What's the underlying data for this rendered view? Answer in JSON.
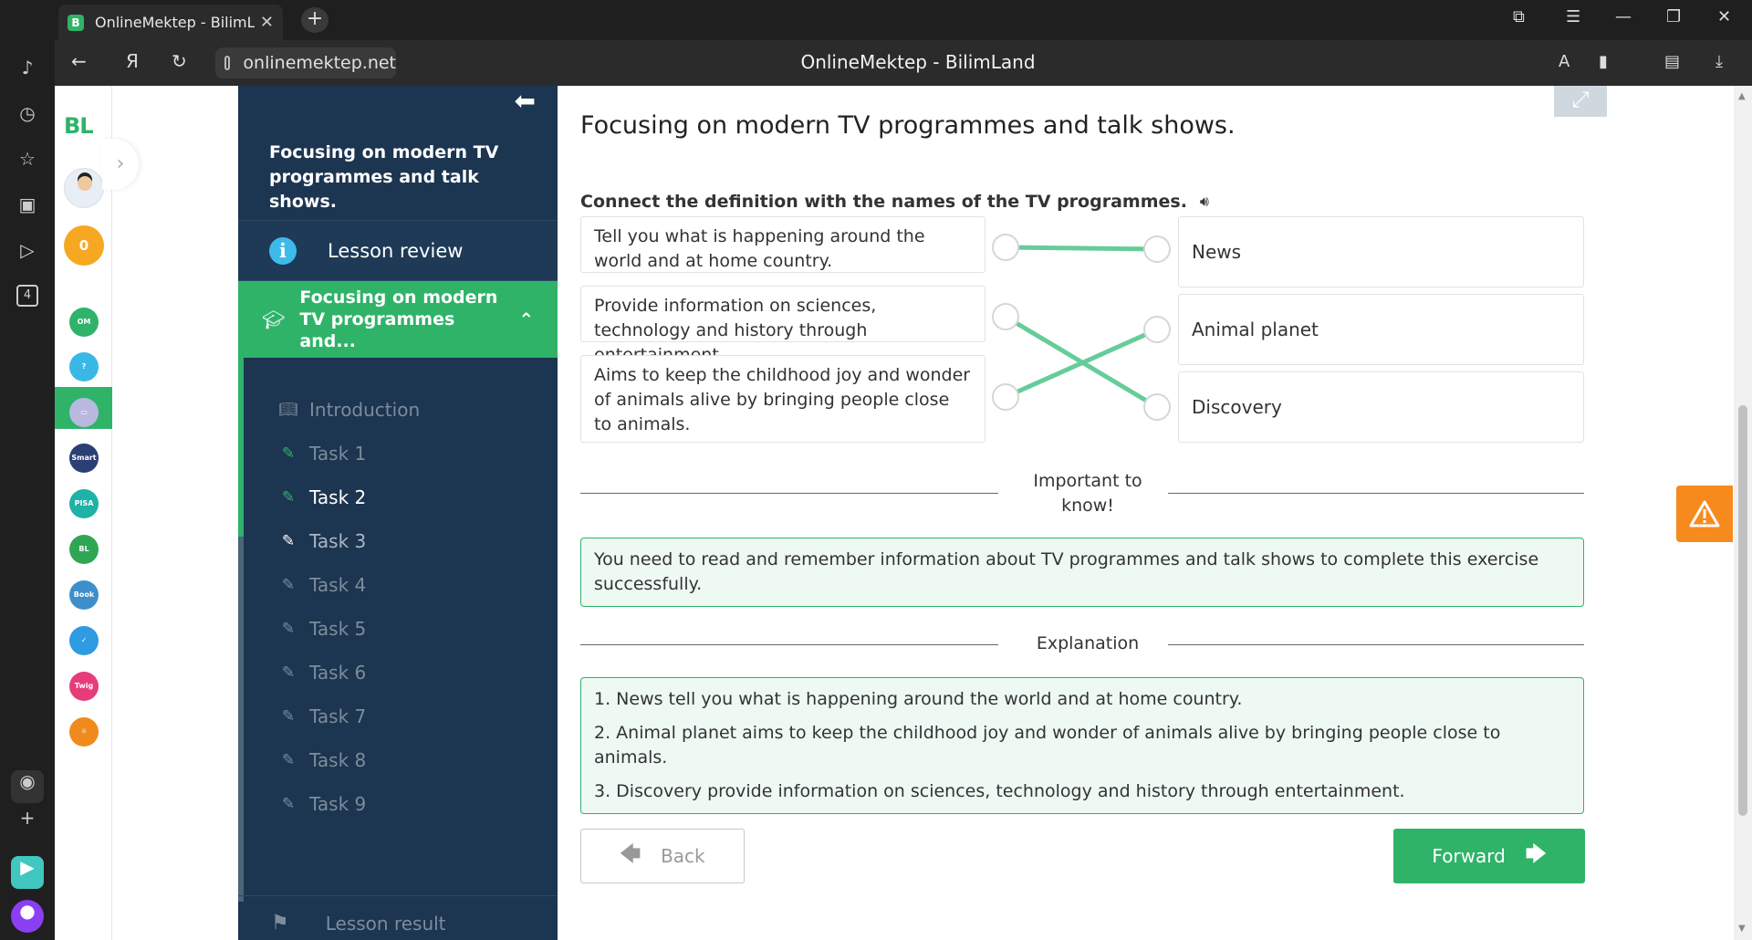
{
  "browser": {
    "tab_title": "OnlineMektep - BilimLand",
    "tab_favicon": "B",
    "url": "onlinemektep.net",
    "page_title": "OnlineMektep - BilimLand",
    "sidebar_badge": "4"
  },
  "site_sidebar": {
    "logo": "BL",
    "coins": "0",
    "apps": [
      {
        "name": "onlinemektep-app",
        "label": "OM",
        "color": "#2fb369"
      },
      {
        "name": "help-app",
        "label": "?",
        "color": "#39b8e6"
      },
      {
        "name": "slides-app",
        "label": "▭",
        "color": "#b9b9e0"
      },
      {
        "name": "smart-nation-app",
        "label": "Smart",
        "color": "#2b3f73"
      },
      {
        "name": "pisa-app",
        "label": "PISA",
        "color": "#1fb2a6"
      },
      {
        "name": "bilimland-app",
        "label": "BL",
        "color": "#2fa654"
      },
      {
        "name": "bilimbook-app",
        "label": "Book",
        "color": "#3d8fcb"
      },
      {
        "name": "itest-app",
        "label": "✓",
        "color": "#2f9be0"
      },
      {
        "name": "twig-app",
        "label": "Twig",
        "color": "#e63c7a"
      },
      {
        "name": "mektep-app",
        "label": "☼",
        "color": "#f08a1d"
      }
    ]
  },
  "lesson_panel": {
    "title": "Focusing on modern TV programmes and talk shows.",
    "review_label": "Lesson review",
    "active_section": "Focusing on modern TV programmes and...",
    "items": [
      "Introduction",
      "Task 1",
      "Task 2",
      "Task 3",
      "Task 4",
      "Task 5",
      "Task 6",
      "Task 7",
      "Task 8",
      "Task 9"
    ],
    "result_label": "Lesson result"
  },
  "main": {
    "heading": "Focusing on modern TV programmes and talk shows.",
    "instruction": "Connect the definition with the names of the TV programmes.",
    "definitions": [
      "Tell you what is happening around the world and at home country.",
      "Provide information on sciences, technology and history through entertainment.",
      "Aims to keep the childhood joy and wonder of animals alive by bringing people close to animals."
    ],
    "names": [
      "News",
      "Animal planet",
      "Discovery"
    ],
    "matches": [
      [
        0,
        0
      ],
      [
        1,
        2
      ],
      [
        2,
        1
      ]
    ],
    "match_color": "#66cc99",
    "important_label": "Important to know!",
    "important_text": "You need to read and remember information about TV programmes and talk shows to complete this exercise successfully.",
    "explanation_label": "Explanation",
    "explanations": [
      "1. News tell you what is happening around the world and at home country.",
      "2. Animal planet aims to keep the childhood joy and wonder of animals alive by bringing people close to animals.",
      "3. Discovery provide information on sciences, technology and history through entertainment."
    ],
    "back_label": "Back",
    "forward_label": "Forward"
  },
  "colors": {
    "accent": "#2fb369",
    "panel": "#1c3550",
    "warning": "#f78a1d"
  }
}
